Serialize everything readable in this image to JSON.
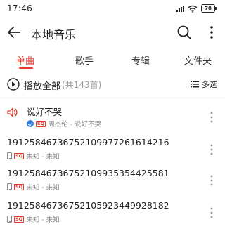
{
  "status_bar": {
    "time": "17:46",
    "battery": "78"
  },
  "header": {
    "title": "本地音乐"
  },
  "tabs": [
    {
      "label": "单曲",
      "active": true
    },
    {
      "label": "歌手",
      "active": false
    },
    {
      "label": "专辑",
      "active": false
    },
    {
      "label": "文件夹",
      "active": false
    }
  ],
  "play_all": {
    "label": "播放全部",
    "count": "(共143首)"
  },
  "multi_select": {
    "label": "多选"
  },
  "songs": [
    {
      "title": "说好不哭",
      "subtitle": "周杰伦 - 说好不哭",
      "playing": true
    },
    {
      "title": "19125846736752109977261614216",
      "subtitle": "未知 - 未知",
      "playing": false
    },
    {
      "title": "19125846736752109935354425581",
      "subtitle": "未知 - 未知",
      "playing": false
    },
    {
      "title": "19125846736752105923449928182",
      "subtitle": "未知 - 未知",
      "playing": false
    }
  ],
  "colors": {
    "accent": "#e8372c",
    "verified": "#2e7fe0",
    "text": "#222222",
    "muted": "#888888"
  }
}
